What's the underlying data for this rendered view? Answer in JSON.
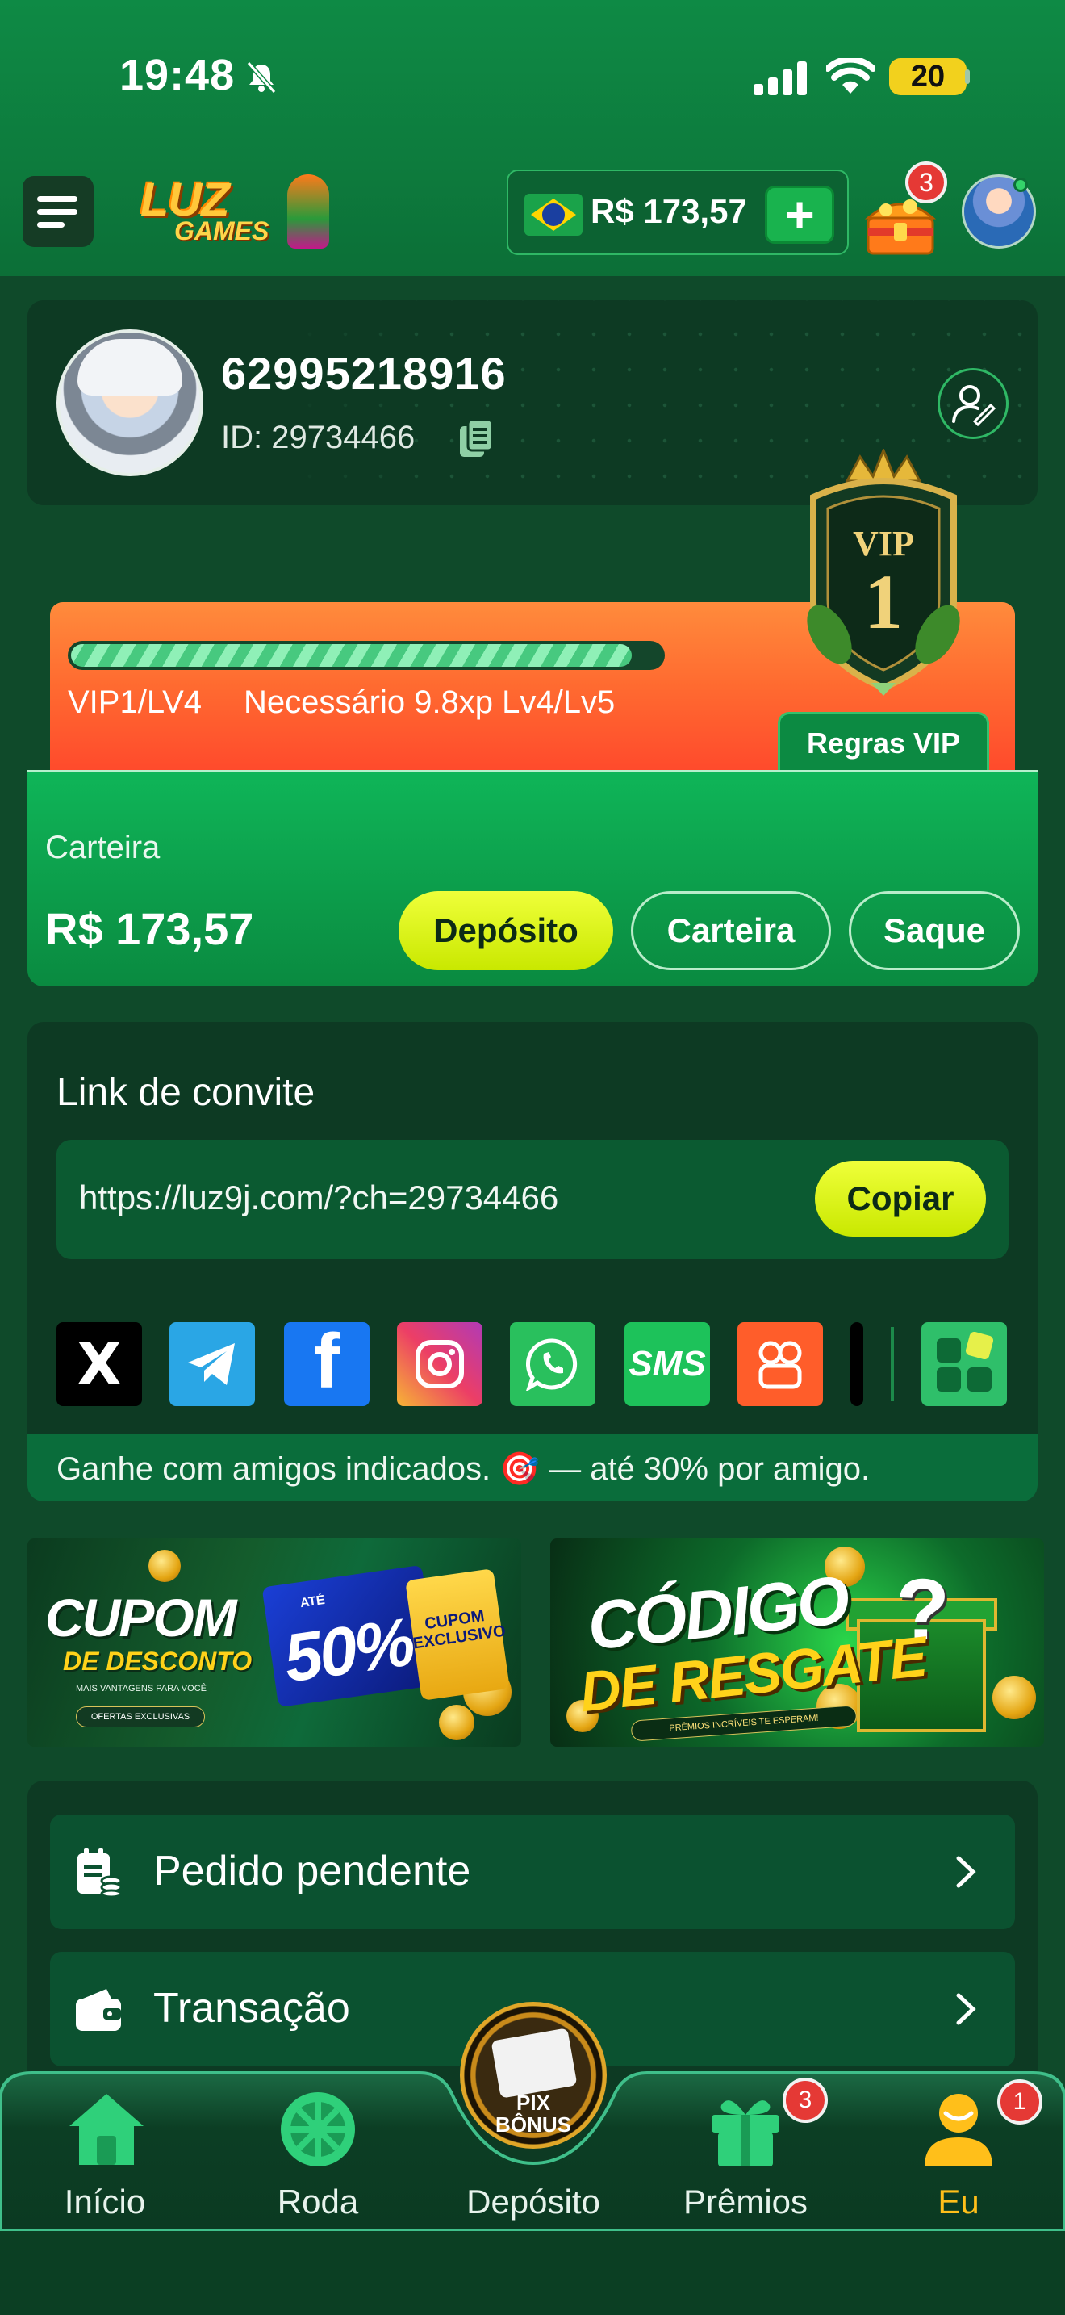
{
  "status_bar": {
    "time": "19:48",
    "battery": "20"
  },
  "header": {
    "logo_line1": "LUZ",
    "logo_line2": "GAMES",
    "balance": "R$ 173,57",
    "add_label": "+",
    "chest_badge": "3"
  },
  "profile": {
    "phone": "62995218916",
    "id_text": "ID: 29734466"
  },
  "vip": {
    "badge_label": "VIP",
    "badge_level": "1",
    "level_text": "VIP1/LV4",
    "needed_text": "Necessário 9.8xp Lv4/Lv5",
    "progress": 0.95,
    "rules_label": "Regras VIP"
  },
  "wallet": {
    "label": "Carteira",
    "amount": "R$ 173,57",
    "deposit_label": "Depósito",
    "wallet_label": "Carteira",
    "withdraw_label": "Saque"
  },
  "invite": {
    "title": "Link de convite",
    "link": "https://luz9j.com/?ch=29734466",
    "copy_label": "Copiar",
    "share_x": "X",
    "share_fb": "f",
    "share_sms": "SMS",
    "note": "Ganhe com amigos indicados. 🎯 — até 30% por amigo."
  },
  "banners": {
    "coupon": {
      "title": "CUPOM",
      "subtitle": "DE DESCONTO",
      "tagline": "MAIS VANTAGENS PARA VOCÊ",
      "pill": "OFERTAS EXCLUSIVAS",
      "ate": "ATÉ",
      "value": "50%",
      "stub": "CUPOM EXCLUSIVO"
    },
    "code": {
      "title": "CÓDIGO",
      "subtitle": "DE RESGATE",
      "tagline": "PRÊMIOS INCRÍVEIS TE ESPERAM!",
      "mark": "?"
    }
  },
  "menu": {
    "items": [
      {
        "label": "Pedido pendente"
      },
      {
        "label": "Transação"
      }
    ]
  },
  "nav": {
    "items": [
      {
        "label": "Início"
      },
      {
        "label": "Roda"
      },
      {
        "label": "Depósito"
      },
      {
        "label": "Prêmios",
        "badge": "3"
      },
      {
        "label": "Eu",
        "badge": "1"
      }
    ],
    "pix_label_1": "PIX",
    "pix_label_2": "BÔNUS"
  },
  "colors": {
    "accent_green": "#0e8a45",
    "yellow_button": "#e3fb1a",
    "vip_orange": "#ff6a30",
    "badge_red": "#e53935",
    "active_nav": "#ffbf1a"
  }
}
